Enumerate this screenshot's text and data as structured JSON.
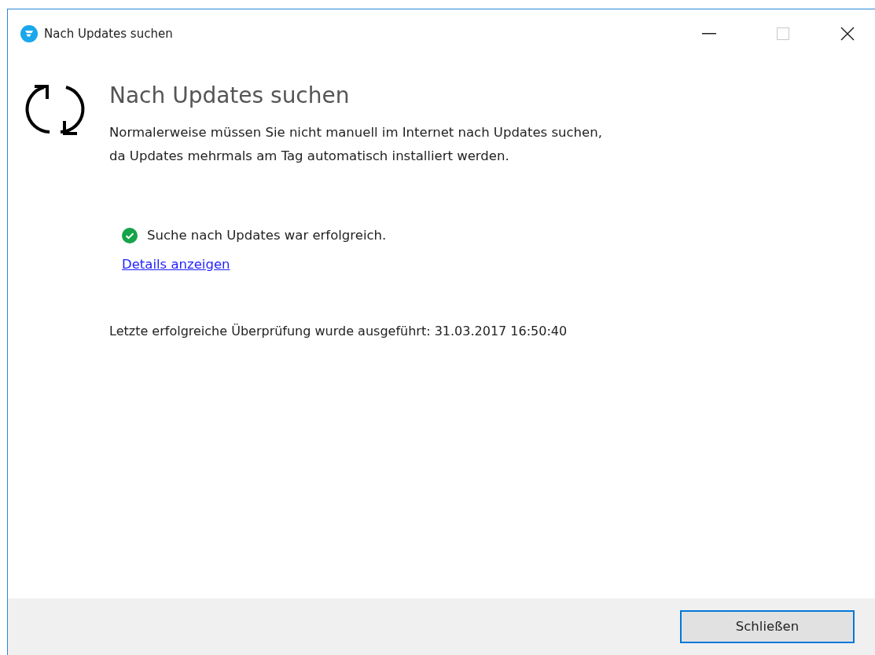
{
  "window": {
    "title": "Nach Updates suchen"
  },
  "heading": "Nach Updates suchen",
  "description_lines": [
    "Normalerweise müssen Sie nicht manuell im Internet nach Updates suchen,",
    "da Updates mehrmals am Tag automatisch installiert werden."
  ],
  "status": {
    "kind": "success",
    "text": "Suche nach Updates war erfolgreich."
  },
  "details_link": "Details anzeigen",
  "last_check": "Letzte erfolgreiche Überprüfung wurde ausgeführt: 31.03.2017 16:50:40",
  "footer": {
    "button": {
      "label": "Schließen",
      "focused": true
    }
  }
}
